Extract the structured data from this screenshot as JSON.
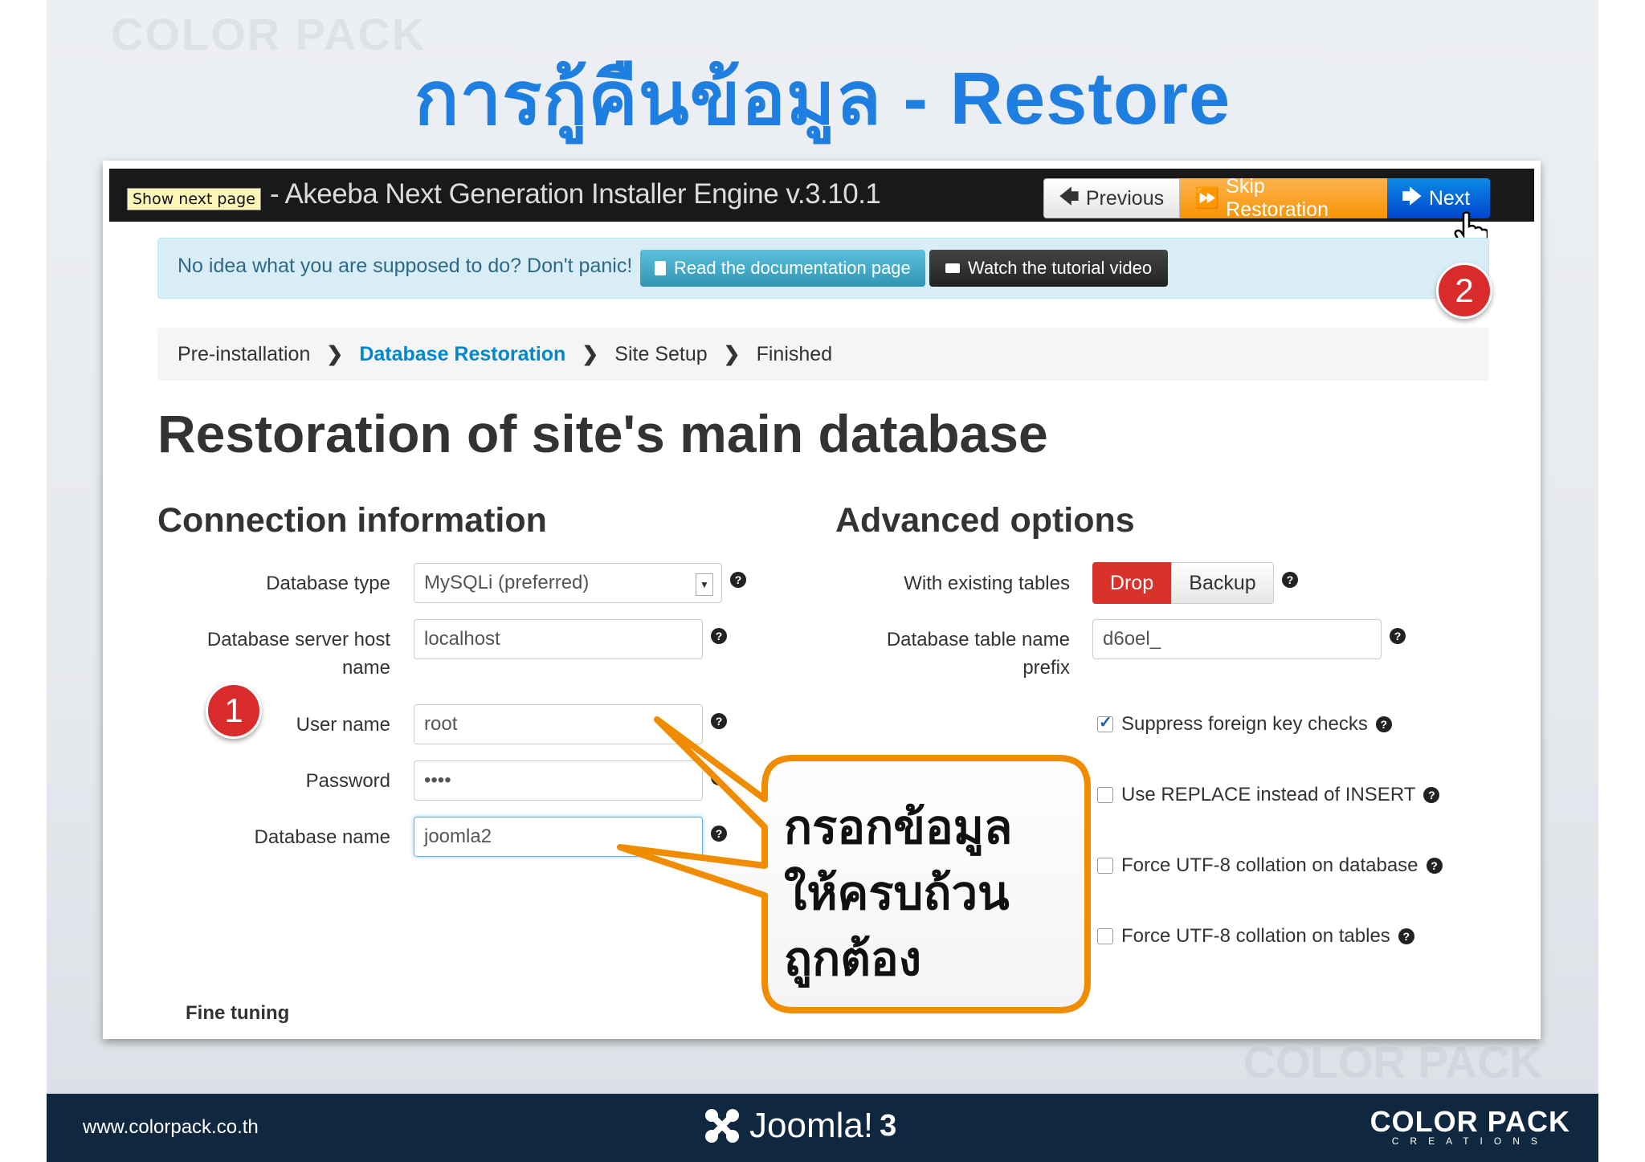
{
  "slide": {
    "title": "การกู้คืนข้อมูล - Restore",
    "watermark": "COLOR PACK"
  },
  "toolbar": {
    "tooltip": "Show next page",
    "title": "- Akeeba Next Generation Installer Engine v.3.10.1",
    "previous_label": "Previous",
    "skip_label": "Skip Restoration",
    "next_label": "Next"
  },
  "info": {
    "text": "No idea what you are supposed to do? Don't panic!",
    "doc_button": "Read the documentation page",
    "video_button": "Watch the tutorial video"
  },
  "markers": {
    "one": "1",
    "two": "2"
  },
  "breadcrumb": {
    "items": [
      "Pre-installation",
      "Database Restoration",
      "Site Setup",
      "Finished"
    ],
    "active_index": 1
  },
  "page": {
    "heading": "Restoration of site's main database",
    "left_section": "Connection information",
    "right_section": "Advanced options",
    "fine_tuning": "Fine tuning"
  },
  "connection": {
    "db_type_label": "Database type",
    "db_type_value": "MySQLi (preferred)",
    "host_label_1": "Database server host",
    "host_label_2": "name",
    "host_value": "localhost",
    "user_label": "User name",
    "user_value": "root",
    "password_label": "Password",
    "password_value": "••••",
    "dbname_label": "Database name",
    "dbname_value": "joomla2"
  },
  "advanced": {
    "existing_label": "With existing tables",
    "drop_label": "Drop",
    "backup_label": "Backup",
    "prefix_label_1": "Database table name",
    "prefix_label_2": "prefix",
    "prefix_value": "d6oel_",
    "options": [
      {
        "label": "Suppress foreign key checks",
        "checked": true
      },
      {
        "label": "Use REPLACE instead of INSERT",
        "checked": false
      },
      {
        "label": "Force UTF-8 collation on database",
        "checked": false
      },
      {
        "label": "Force UTF-8 collation on tables",
        "checked": false
      }
    ]
  },
  "callout": {
    "line1": "กรอกข้อมูล",
    "line2": "ให้ครบถ้วน",
    "line3": "ถูกต้อง"
  },
  "footer": {
    "url": "www.colorpack.co.th",
    "joomla": "Joomla!",
    "joomla_version": "3",
    "brand": "COLOR PACK",
    "brand_sub": "CREATIONS"
  },
  "colors": {
    "title": "#1e7fe0",
    "skip": "#f89406",
    "next": "#0044cc",
    "drop": "#d9322b",
    "marker": "#d92b2b",
    "callout_border": "#f08c00",
    "footer": "#102740"
  }
}
